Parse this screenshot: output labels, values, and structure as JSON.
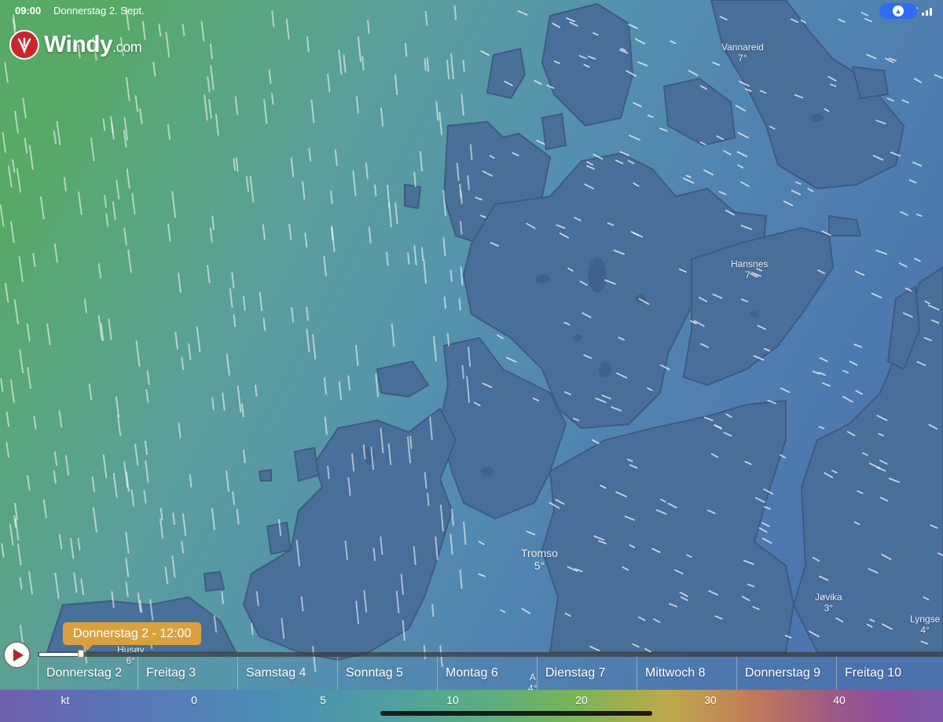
{
  "status_bar": {
    "time": "09:00",
    "date": "Donnerstag 2. Sept."
  },
  "logo": {
    "name": "Windy",
    "suffix": ".com"
  },
  "cities": [
    {
      "name": "Vannareid",
      "temp": "7°"
    },
    {
      "name": "Hansnes",
      "temp": "7°"
    },
    {
      "name": "Tromso",
      "temp": "5°"
    },
    {
      "name": "Jøvika",
      "temp": "3°"
    },
    {
      "name": "Lyngse",
      "temp": "4°"
    },
    {
      "name": "Husøy",
      "temp": "6°"
    },
    {
      "name": "A",
      "temp": "4°"
    }
  ],
  "timeline": {
    "tooltip": "Donnerstag 2 - 12:00",
    "progress": 0.046,
    "days": [
      "Donnerstag 2",
      "Freitag 3",
      "Samstag 4",
      "Sonntag 5",
      "Montag 6",
      "Dienstag 7",
      "Mittwoch 8",
      "Donnerstag 9",
      "Freitag 10"
    ]
  },
  "legend": {
    "unit": "kt",
    "values": [
      "0",
      "5",
      "10",
      "20",
      "30",
      "40"
    ]
  },
  "colors": {
    "land": "#486e99",
    "sea_east": "#4f74ad",
    "sea_west": "#5aa66a",
    "tooltip": "#d9a13e",
    "play_icon": "#b5232a",
    "logo": "#c8272c"
  }
}
